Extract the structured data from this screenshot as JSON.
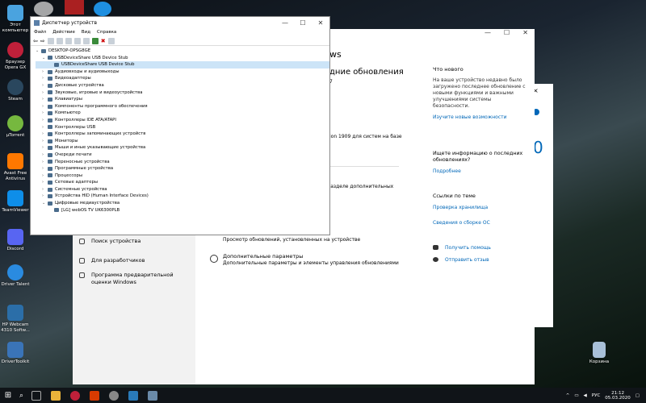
{
  "desktop": {
    "icons": [
      {
        "label": "Этот компьютер",
        "color": "#4aa3df"
      },
      {
        "label": "Браузер Opera GX",
        "color": "#c0203a"
      },
      {
        "label": "Steam",
        "color": "#1b2838"
      },
      {
        "label": "µTorrent",
        "color": "#76b83f"
      },
      {
        "label": "Avast Free Antivirus",
        "color": "#ff7800"
      },
      {
        "label": "TeamViewer",
        "color": "#0e8ee9"
      },
      {
        "label": "Discord",
        "color": "#5865f2"
      },
      {
        "label": "Driver Talent",
        "color": "#2a8be0"
      },
      {
        "label": "HP Webcam 4310 Softw...",
        "color": "#2b6ea8"
      },
      {
        "label": "DriverToolkit",
        "color": "#3a74b8"
      }
    ],
    "recycle": "Корзина"
  },
  "devmgr": {
    "title": "Диспетчер устройств",
    "menu": [
      "Файл",
      "Действие",
      "Вид",
      "Справка"
    ],
    "tree": [
      {
        "label": "DESKTOP-OPSG8GE",
        "level": 0,
        "exp": "⌄"
      },
      {
        "label": "USBDeviceShare USB Device Stub",
        "level": 1,
        "exp": "⌄"
      },
      {
        "label": "USBDeviceShare USB Device Stub",
        "level": 2,
        "exp": "",
        "sel": true
      },
      {
        "label": "Аудиовходы и аудиовыходы",
        "level": 1,
        "exp": "›"
      },
      {
        "label": "Видеоадаптеры",
        "level": 1,
        "exp": "›"
      },
      {
        "label": "Дисковые устройства",
        "level": 1,
        "exp": "›"
      },
      {
        "label": "Звуковые, игровые и видеоустройства",
        "level": 1,
        "exp": "›"
      },
      {
        "label": "Клавиатуры",
        "level": 1,
        "exp": "›"
      },
      {
        "label": "Компоненты программного обеспечения",
        "level": 1,
        "exp": "›"
      },
      {
        "label": "Компьютер",
        "level": 1,
        "exp": "›"
      },
      {
        "label": "Контроллеры IDE ATA/ATAPI",
        "level": 1,
        "exp": "›"
      },
      {
        "label": "Контроллеры USB",
        "level": 1,
        "exp": "›"
      },
      {
        "label": "Контроллеры запоминающих устройств",
        "level": 1,
        "exp": "›"
      },
      {
        "label": "Мониторы",
        "level": 1,
        "exp": "›"
      },
      {
        "label": "Мыши и иные указывающие устройства",
        "level": 1,
        "exp": "›"
      },
      {
        "label": "Очереди печати",
        "level": 1,
        "exp": "›"
      },
      {
        "label": "Переносные устройства",
        "level": 1,
        "exp": "›"
      },
      {
        "label": "Программные устройства",
        "level": 1,
        "exp": "›"
      },
      {
        "label": "Процессоры",
        "level": 1,
        "exp": "›"
      },
      {
        "label": "Сетевые адаптеры",
        "level": 1,
        "exp": "›"
      },
      {
        "label": "Системные устройства",
        "level": 1,
        "exp": "›"
      },
      {
        "label": "Устройства HID (Human Interface Devices)",
        "level": 1,
        "exp": "›"
      },
      {
        "label": "Цифровые медиаустройства",
        "level": 1,
        "exp": "⌄"
      },
      {
        "label": "[LG] webOS TV UK6300PLB",
        "level": 2,
        "exp": ""
      }
    ]
  },
  "settings": {
    "bg_title": "ws",
    "heading": "дние обновления",
    "heading_sub": "7",
    "version_text": "ion 1909 для систем на базе",
    "additional_link": "в разделе дополнительных",
    "side": [
      {
        "label": "Поиск устройства"
      },
      {
        "label": "Для разработчиков"
      },
      {
        "label": "Программа предварительной оценки Windows"
      }
    ],
    "history_desc": "Просмотр обновлений, установленных на устройстве",
    "adv_title": "Дополнительные параметры",
    "adv_desc": "Дополнительные параметры и элементы управления обновлениями",
    "whats_new_title": "Что нового",
    "whats_new_text": "На ваше устройство недавно было загружено последнее обновление с новыми функциями и важными улучшениями системы безопасности.",
    "whats_new_link": "Изучите новые возможности",
    "info_title": "Ищете информацию о последних обновлениях?",
    "info_link": "Подробнее",
    "related_title": "Ссылки по теме",
    "related_links": [
      "Проверка хранилища",
      "Сведения о сборке ОС"
    ],
    "help": "Получить помощь",
    "feedback": "Отправить отзыв"
  },
  "taskbar": {
    "lang": "РУС",
    "time": "21:12",
    "date": "05.03.2020"
  }
}
